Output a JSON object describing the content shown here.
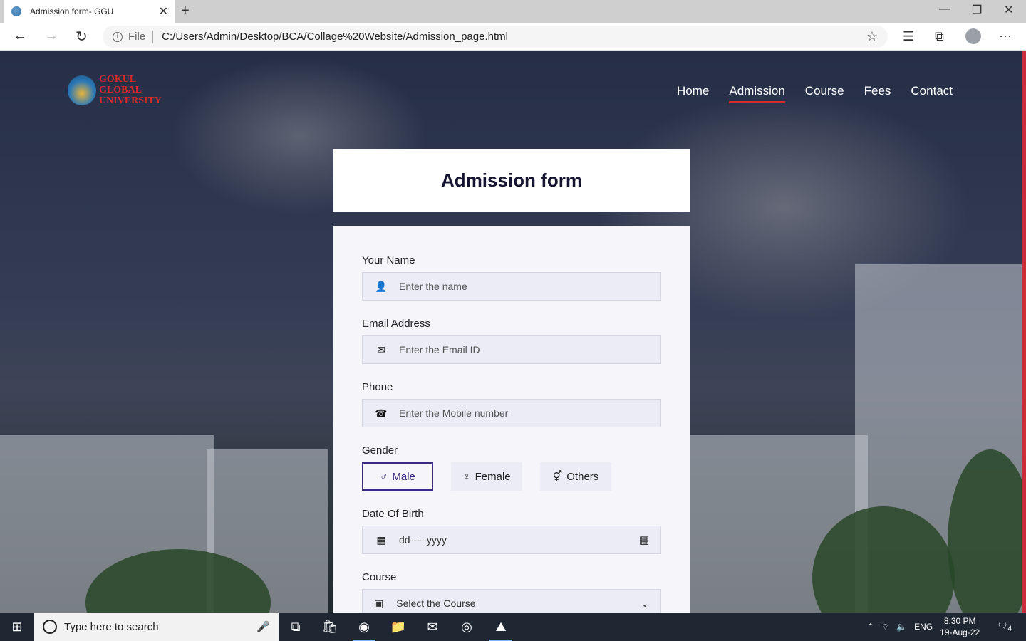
{
  "browser": {
    "tab_title": "Admission form- GGU",
    "address_scheme_label": "File",
    "url": "C:/Users/Admin/Desktop/BCA/Collage%20Website/Admission_page.html"
  },
  "site": {
    "logo_lines": [
      "GOKUL",
      "GLOBAL",
      "UNIVERSITY"
    ],
    "nav": [
      "Home",
      "Admission",
      "Course",
      "Fees",
      "Contact"
    ],
    "active_nav": "Admission"
  },
  "form": {
    "title": "Admission form",
    "name_label": "Your Name",
    "name_placeholder": "Enter the name",
    "email_label": "Email Address",
    "email_placeholder": "Enter the Email ID",
    "phone_label": "Phone",
    "phone_placeholder": "Enter the Mobile number",
    "gender_label": "Gender",
    "gender_options": [
      "Male",
      "Female",
      "Others"
    ],
    "gender_selected": "Male",
    "dob_label": "Date Of Birth",
    "dob_value": "dd-----yyyy",
    "course_label": "Course",
    "course_placeholder": "Select the Course"
  },
  "taskbar": {
    "search_placeholder": "Type here to search",
    "language": "ENG",
    "time": "8:30 PM",
    "date": "19-Aug-22",
    "notification_count": "4"
  },
  "colors": {
    "accent": "#d62a2a",
    "form_active": "#3c2a80",
    "heading": "#151533"
  }
}
